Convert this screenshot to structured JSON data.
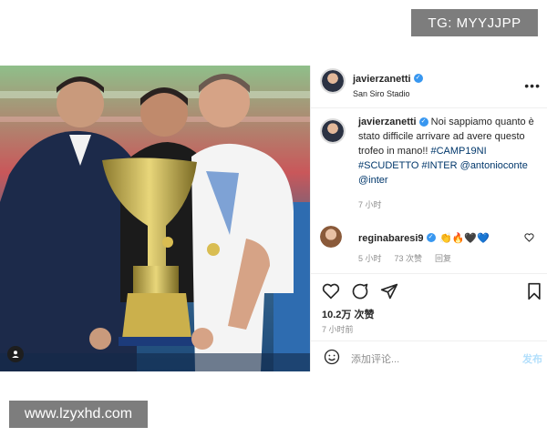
{
  "watermarks": {
    "top": "TG: MYYJJPP",
    "bottom": "www.lzyxhd.com"
  },
  "post": {
    "header": {
      "username": "javierzanetti",
      "location": "San Siro Stadio",
      "more_icon": "more-horizontal-icon"
    },
    "caption": {
      "username": "javierzanetti",
      "text": "Noi sappiamo quanto è stato difficile arrivare ad avere questo trofeo in mano!!",
      "tags": "#CAMP19NI #SCUDETTO #INTER @antonioconte @inter",
      "time": "7 小时"
    },
    "comment": {
      "username": "reginabaresi9",
      "emojis": "👏🔥🖤💙",
      "time": "5 小时",
      "likes": "73 次赞",
      "reply": "回复"
    },
    "actions": {
      "likes": "10.2万 次赞",
      "time": "7 小时前"
    },
    "add_comment": {
      "placeholder": "添加评论...",
      "publish": "发布"
    },
    "colors": {
      "verified": "#3897f0",
      "hashtag": "#00376b",
      "muted": "#8e8e8e",
      "publish_disabled": "#b2dffc"
    }
  }
}
